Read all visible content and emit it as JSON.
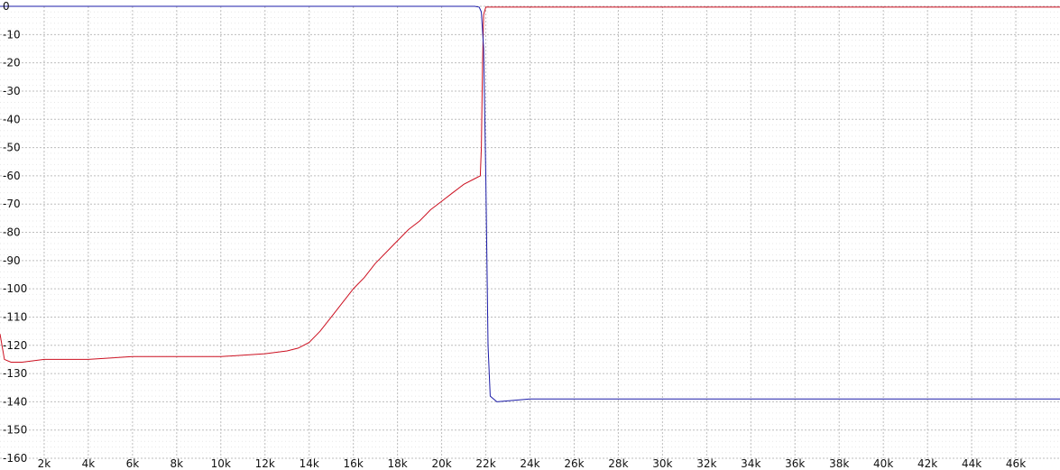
{
  "chart_data": {
    "type": "line",
    "title": "",
    "xlabel": "",
    "ylabel": "",
    "xlim": [
      0,
      48000
    ],
    "ylim": [
      -160,
      0
    ],
    "grid": true,
    "legend": "none",
    "x_ticks": [
      {
        "value": 2000,
        "label": "2k"
      },
      {
        "value": 4000,
        "label": "4k"
      },
      {
        "value": 6000,
        "label": "6k"
      },
      {
        "value": 8000,
        "label": "8k"
      },
      {
        "value": 10000,
        "label": "10k"
      },
      {
        "value": 12000,
        "label": "12k"
      },
      {
        "value": 14000,
        "label": "14k"
      },
      {
        "value": 16000,
        "label": "16k"
      },
      {
        "value": 18000,
        "label": "18k"
      },
      {
        "value": 20000,
        "label": "20k"
      },
      {
        "value": 22000,
        "label": "22k"
      },
      {
        "value": 24000,
        "label": "24k"
      },
      {
        "value": 26000,
        "label": "26k"
      },
      {
        "value": 28000,
        "label": "28k"
      },
      {
        "value": 30000,
        "label": "30k"
      },
      {
        "value": 32000,
        "label": "32k"
      },
      {
        "value": 34000,
        "label": "34k"
      },
      {
        "value": 36000,
        "label": "36k"
      },
      {
        "value": 38000,
        "label": "38k"
      },
      {
        "value": 40000,
        "label": "40k"
      },
      {
        "value": 42000,
        "label": "42k"
      },
      {
        "value": 44000,
        "label": "44k"
      },
      {
        "value": 46000,
        "label": "46k"
      }
    ],
    "y_ticks": [
      {
        "value": 0,
        "label": "0"
      },
      {
        "value": -10,
        "label": "-10"
      },
      {
        "value": -20,
        "label": "-20"
      },
      {
        "value": -30,
        "label": "-30"
      },
      {
        "value": -40,
        "label": "-40"
      },
      {
        "value": -50,
        "label": "-50"
      },
      {
        "value": -60,
        "label": "-60"
      },
      {
        "value": -70,
        "label": "-70"
      },
      {
        "value": -80,
        "label": "-80"
      },
      {
        "value": -90,
        "label": "-90"
      },
      {
        "value": -100,
        "label": "-100"
      },
      {
        "value": -110,
        "label": "-110"
      },
      {
        "value": -120,
        "label": "-120"
      },
      {
        "value": -130,
        "label": "-130"
      },
      {
        "value": -140,
        "label": "-140"
      },
      {
        "value": -150,
        "label": "-150"
      },
      {
        "value": -160,
        "label": "-160"
      }
    ],
    "series": [
      {
        "color": "#cc1020",
        "x": [
          0,
          200,
          500,
          1000,
          2000,
          3000,
          4000,
          6000,
          8000,
          10000,
          12000,
          13000,
          13500,
          14000,
          14500,
          15000,
          15500,
          16000,
          16500,
          17000,
          17500,
          18000,
          18500,
          19000,
          19500,
          20000,
          20500,
          21000,
          21500,
          21750,
          21800,
          21850,
          21900,
          22000,
          22200,
          23000,
          26000,
          30000,
          34000,
          38000,
          42000,
          46000,
          48000
        ],
        "y": [
          -116,
          -125,
          -126,
          -126,
          -125,
          -125,
          -125,
          -124,
          -124,
          -124,
          -123,
          -122,
          -121,
          -119,
          -115,
          -110,
          -105,
          -100,
          -96,
          -91,
          -87,
          -83,
          -79,
          -76,
          -72,
          -69,
          -66,
          -63,
          -61,
          -60,
          -50,
          -20,
          -3,
          -0.3,
          -0.3,
          -0.3,
          -0.3,
          -0.3,
          -0.3,
          -0.3,
          -0.3,
          -0.3,
          -0.3
        ]
      },
      {
        "color": "#1c1ca8",
        "x": [
          0,
          5000,
          10000,
          15000,
          20000,
          21500,
          21700,
          21800,
          21900,
          22000,
          22100,
          22200,
          22500,
          24000,
          26000,
          28000,
          30000,
          32000,
          34000,
          36000,
          38000,
          40000,
          42000,
          44000,
          46000,
          48000
        ],
        "y": [
          0,
          0,
          0,
          0,
          0,
          0,
          -0.3,
          -2,
          -15,
          -60,
          -120,
          -138,
          -140,
          -139,
          -139,
          -139,
          -139,
          -139,
          -139,
          -139,
          -139,
          -139,
          -139,
          -139,
          -139,
          -139
        ]
      }
    ]
  }
}
